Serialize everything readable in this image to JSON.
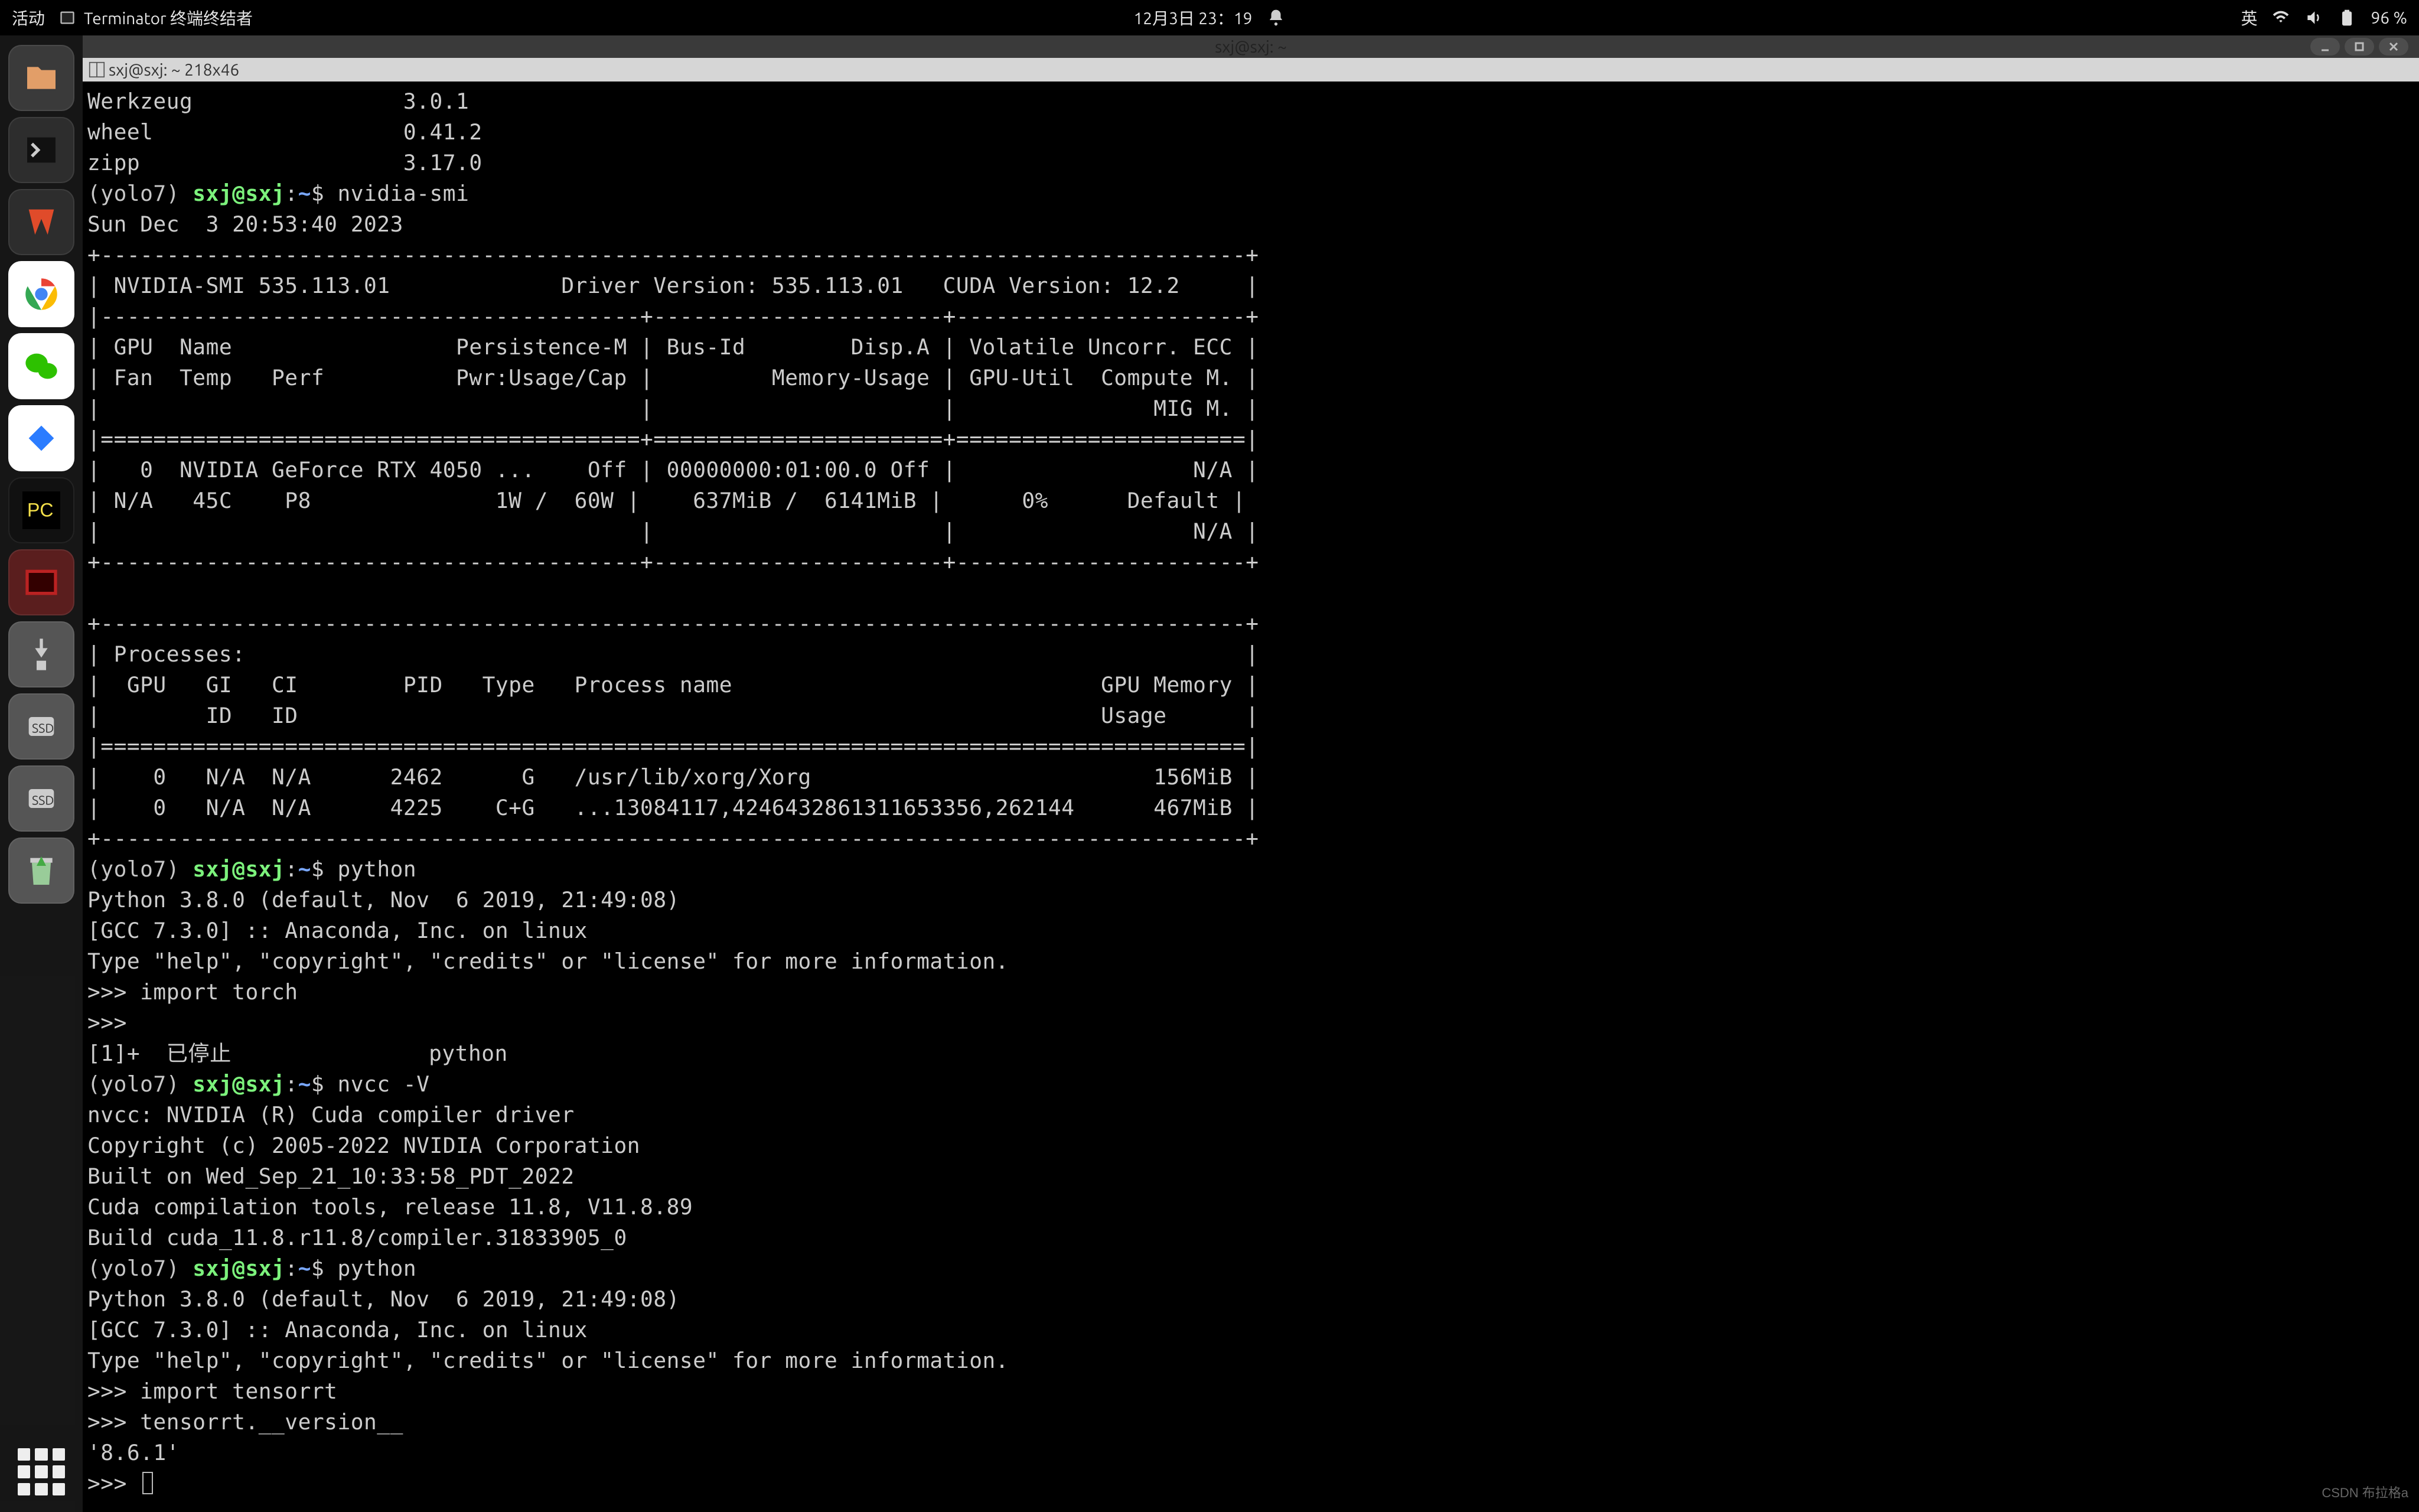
{
  "topbar": {
    "activities": "活动",
    "app_name": "Terminator 终端终结者",
    "datetime": "12月3日 23：19",
    "lang_indicator": "英",
    "battery_pct": "96 %"
  },
  "window": {
    "title": "sxj@sxj: ~",
    "tab_label": "sxj@sxj: ~ 218x46"
  },
  "prompt": {
    "env": "(yolo7) ",
    "user_host": "sxj@sxj",
    "colon": ":",
    "path": "~",
    "sigil": "$"
  },
  "dock": {
    "items": [
      "files",
      "terminal",
      "wps",
      "chrome",
      "wechat",
      "browser",
      "pycharm",
      "terminator",
      "usb",
      "ssd1",
      "ssd2",
      "trash"
    ]
  },
  "term": {
    "pip_list": [
      "Werkzeug                3.0.1",
      "wheel                   0.41.2",
      "zipp                    3.17.0"
    ],
    "cmd_nvidia_smi": "nvidia-smi",
    "nvidia_smi_date": "Sun Dec  3 20:53:40 2023",
    "nvidia_smi_block": [
      "+---------------------------------------------------------------------------------------+",
      "| NVIDIA-SMI 535.113.01             Driver Version: 535.113.01   CUDA Version: 12.2     |",
      "|-----------------------------------------+----------------------+----------------------+",
      "| GPU  Name                 Persistence-M | Bus-Id        Disp.A | Volatile Uncorr. ECC |",
      "| Fan  Temp   Perf          Pwr:Usage/Cap |         Memory-Usage | GPU-Util  Compute M. |",
      "|                                         |                      |               MIG M. |",
      "|=========================================+======================+======================|",
      "|   0  NVIDIA GeForce RTX 4050 ...    Off | 00000000:01:00.0 Off |                  N/A |",
      "| N/A   45C    P8              1W /  60W |    637MiB /  6141MiB |      0%      Default |",
      "|                                         |                      |                  N/A |",
      "+-----------------------------------------+----------------------+----------------------+",
      "",
      "+---------------------------------------------------------------------------------------+",
      "| Processes:                                                                            |",
      "|  GPU   GI   CI        PID   Type   Process name                            GPU Memory |",
      "|        ID   ID                                                             Usage      |",
      "|=======================================================================================|",
      "|    0   N/A  N/A      2462      G   /usr/lib/xorg/Xorg                          156MiB |",
      "|    0   N/A  N/A      4225    C+G   ...13084117,4246432861311653356,262144      467MiB |",
      "+---------------------------------------------------------------------------------------+"
    ],
    "cmd_python1": "python",
    "py_header": [
      "Python 3.8.0 (default, Nov  6 2019, 21:49:08)",
      "[GCC 7.3.0] :: Anaconda, Inc. on linux",
      "Type \"help\", \"copyright\", \"credits\" or \"license\" for more information."
    ],
    "py_import_torch": ">>> import torch",
    "py_empty": ">>>",
    "py_stopped": "[1]+  已停止               python",
    "cmd_nvcc": "nvcc -V",
    "nvcc_out": [
      "nvcc: NVIDIA (R) Cuda compiler driver",
      "Copyright (c) 2005-2022 NVIDIA Corporation",
      "Built on Wed_Sep_21_10:33:58_PDT_2022",
      "Cuda compilation tools, release 11.8, V11.8.89",
      "Build cuda_11.8.r11.8/compiler.31833905_0"
    ],
    "cmd_python2": "python",
    "py_import_trt": ">>> import tensorrt",
    "py_trt_ver_call": ">>> tensorrt.__version__",
    "py_trt_ver_out": "'8.6.1'",
    "py_prompt": ">>> "
  },
  "watermark": "CSDN 布拉格a"
}
